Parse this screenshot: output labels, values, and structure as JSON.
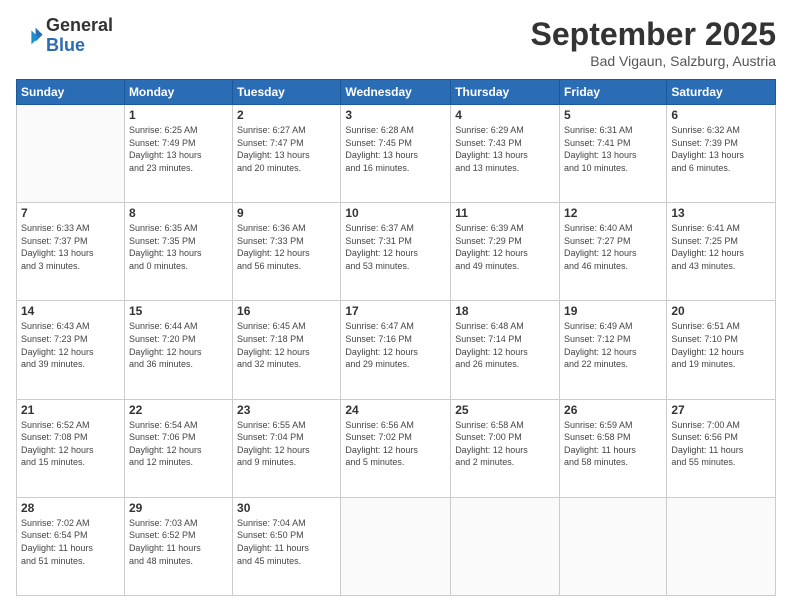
{
  "logo": {
    "general": "General",
    "blue": "Blue"
  },
  "title": "September 2025",
  "subtitle": "Bad Vigaun, Salzburg, Austria",
  "days_of_week": [
    "Sunday",
    "Monday",
    "Tuesday",
    "Wednesday",
    "Thursday",
    "Friday",
    "Saturday"
  ],
  "weeks": [
    [
      {
        "day": "",
        "info": ""
      },
      {
        "day": "1",
        "info": "Sunrise: 6:25 AM\nSunset: 7:49 PM\nDaylight: 13 hours\nand 23 minutes."
      },
      {
        "day": "2",
        "info": "Sunrise: 6:27 AM\nSunset: 7:47 PM\nDaylight: 13 hours\nand 20 minutes."
      },
      {
        "day": "3",
        "info": "Sunrise: 6:28 AM\nSunset: 7:45 PM\nDaylight: 13 hours\nand 16 minutes."
      },
      {
        "day": "4",
        "info": "Sunrise: 6:29 AM\nSunset: 7:43 PM\nDaylight: 13 hours\nand 13 minutes."
      },
      {
        "day": "5",
        "info": "Sunrise: 6:31 AM\nSunset: 7:41 PM\nDaylight: 13 hours\nand 10 minutes."
      },
      {
        "day": "6",
        "info": "Sunrise: 6:32 AM\nSunset: 7:39 PM\nDaylight: 13 hours\nand 6 minutes."
      }
    ],
    [
      {
        "day": "7",
        "info": "Sunrise: 6:33 AM\nSunset: 7:37 PM\nDaylight: 13 hours\nand 3 minutes."
      },
      {
        "day": "8",
        "info": "Sunrise: 6:35 AM\nSunset: 7:35 PM\nDaylight: 13 hours\nand 0 minutes."
      },
      {
        "day": "9",
        "info": "Sunrise: 6:36 AM\nSunset: 7:33 PM\nDaylight: 12 hours\nand 56 minutes."
      },
      {
        "day": "10",
        "info": "Sunrise: 6:37 AM\nSunset: 7:31 PM\nDaylight: 12 hours\nand 53 minutes."
      },
      {
        "day": "11",
        "info": "Sunrise: 6:39 AM\nSunset: 7:29 PM\nDaylight: 12 hours\nand 49 minutes."
      },
      {
        "day": "12",
        "info": "Sunrise: 6:40 AM\nSunset: 7:27 PM\nDaylight: 12 hours\nand 46 minutes."
      },
      {
        "day": "13",
        "info": "Sunrise: 6:41 AM\nSunset: 7:25 PM\nDaylight: 12 hours\nand 43 minutes."
      }
    ],
    [
      {
        "day": "14",
        "info": "Sunrise: 6:43 AM\nSunset: 7:23 PM\nDaylight: 12 hours\nand 39 minutes."
      },
      {
        "day": "15",
        "info": "Sunrise: 6:44 AM\nSunset: 7:20 PM\nDaylight: 12 hours\nand 36 minutes."
      },
      {
        "day": "16",
        "info": "Sunrise: 6:45 AM\nSunset: 7:18 PM\nDaylight: 12 hours\nand 32 minutes."
      },
      {
        "day": "17",
        "info": "Sunrise: 6:47 AM\nSunset: 7:16 PM\nDaylight: 12 hours\nand 29 minutes."
      },
      {
        "day": "18",
        "info": "Sunrise: 6:48 AM\nSunset: 7:14 PM\nDaylight: 12 hours\nand 26 minutes."
      },
      {
        "day": "19",
        "info": "Sunrise: 6:49 AM\nSunset: 7:12 PM\nDaylight: 12 hours\nand 22 minutes."
      },
      {
        "day": "20",
        "info": "Sunrise: 6:51 AM\nSunset: 7:10 PM\nDaylight: 12 hours\nand 19 minutes."
      }
    ],
    [
      {
        "day": "21",
        "info": "Sunrise: 6:52 AM\nSunset: 7:08 PM\nDaylight: 12 hours\nand 15 minutes."
      },
      {
        "day": "22",
        "info": "Sunrise: 6:54 AM\nSunset: 7:06 PM\nDaylight: 12 hours\nand 12 minutes."
      },
      {
        "day": "23",
        "info": "Sunrise: 6:55 AM\nSunset: 7:04 PM\nDaylight: 12 hours\nand 9 minutes."
      },
      {
        "day": "24",
        "info": "Sunrise: 6:56 AM\nSunset: 7:02 PM\nDaylight: 12 hours\nand 5 minutes."
      },
      {
        "day": "25",
        "info": "Sunrise: 6:58 AM\nSunset: 7:00 PM\nDaylight: 12 hours\nand 2 minutes."
      },
      {
        "day": "26",
        "info": "Sunrise: 6:59 AM\nSunset: 6:58 PM\nDaylight: 11 hours\nand 58 minutes."
      },
      {
        "day": "27",
        "info": "Sunrise: 7:00 AM\nSunset: 6:56 PM\nDaylight: 11 hours\nand 55 minutes."
      }
    ],
    [
      {
        "day": "28",
        "info": "Sunrise: 7:02 AM\nSunset: 6:54 PM\nDaylight: 11 hours\nand 51 minutes."
      },
      {
        "day": "29",
        "info": "Sunrise: 7:03 AM\nSunset: 6:52 PM\nDaylight: 11 hours\nand 48 minutes."
      },
      {
        "day": "30",
        "info": "Sunrise: 7:04 AM\nSunset: 6:50 PM\nDaylight: 11 hours\nand 45 minutes."
      },
      {
        "day": "",
        "info": ""
      },
      {
        "day": "",
        "info": ""
      },
      {
        "day": "",
        "info": ""
      },
      {
        "day": "",
        "info": ""
      }
    ]
  ]
}
